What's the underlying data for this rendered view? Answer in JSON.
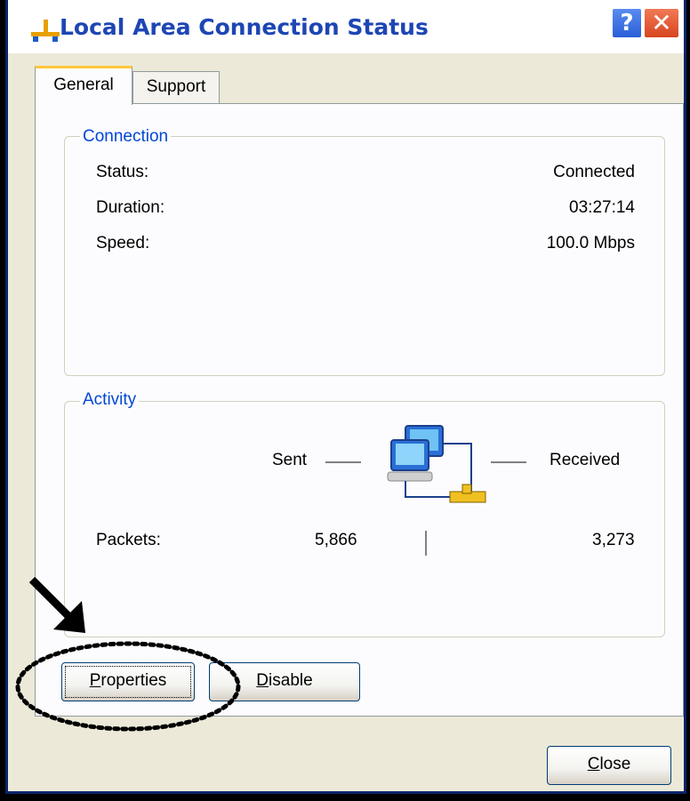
{
  "window": {
    "title": "Local Area Connection Status"
  },
  "tabs": [
    {
      "label": "General"
    },
    {
      "label": "Support"
    }
  ],
  "connection": {
    "group_label": "Connection",
    "rows": [
      {
        "label": "Status:",
        "value": "Connected"
      },
      {
        "label": "Duration:",
        "value": "03:27:14"
      },
      {
        "label": "Speed:",
        "value": "100.0 Mbps"
      }
    ]
  },
  "activity": {
    "group_label": "Activity",
    "sent_label": "Sent",
    "received_label": "Received",
    "packets_label": "Packets:",
    "packets_sent": "5,866",
    "packets_received": "3,273"
  },
  "buttons": {
    "properties": {
      "label": "Properties",
      "mnemonic": "P",
      "rest": "roperties"
    },
    "disable": {
      "label": "Disable",
      "mnemonic": "D",
      "rest": "isable"
    },
    "close": {
      "label": "Close",
      "mnemonic": "C",
      "rest": "lose"
    }
  },
  "annotations": {
    "arrow_icon": "black-arrow-icon",
    "highlight_shape": "dotted-ellipse"
  },
  "colors": {
    "title_text": "#1e46b4",
    "group_label": "#0046d5",
    "tab_highlight": "#ffc83c",
    "dialog_bg": "#ece9d8"
  }
}
